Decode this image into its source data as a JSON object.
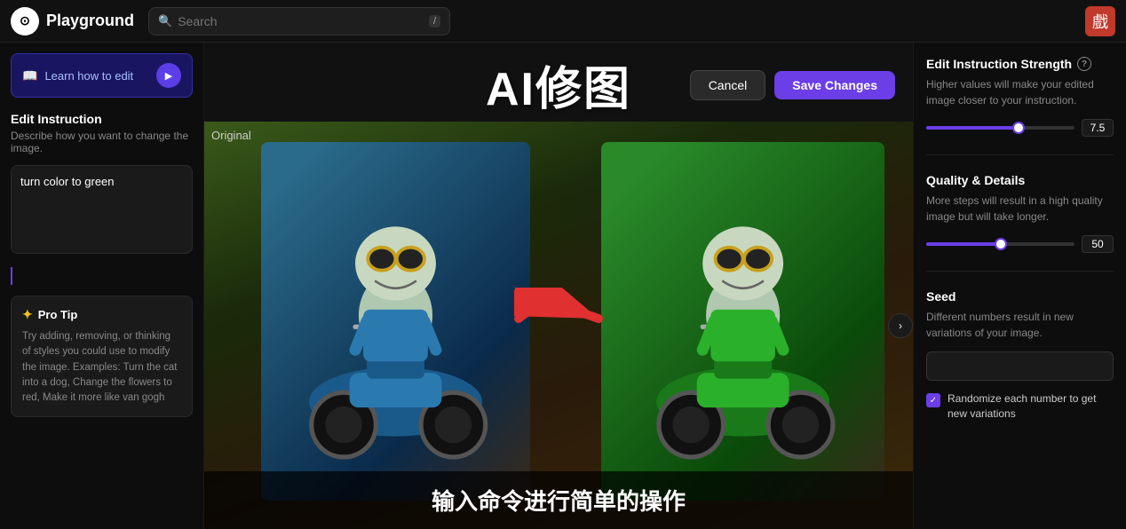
{
  "topnav": {
    "logo_icon": "⊙",
    "logo_text": "Playground",
    "search_placeholder": "Search",
    "search_kbd": "/",
    "avatar_emoji": "戲"
  },
  "sidebar": {
    "learn_btn_label": "Learn how to edit",
    "edit_instruction_title": "Edit Instruction",
    "edit_instruction_desc": "Describe how you want to change the image.",
    "instruction_value": "turn color to green",
    "pro_tip_header": "Pro Tip",
    "pro_tip_text": "Try adding, removing, or thinking of styles you could use to modify the image. Examples: Turn the cat into a dog, Change the flowers to red, Make it more like van gogh"
  },
  "canvas": {
    "title": "AI修图",
    "cancel_label": "Cancel",
    "save_label": "Save Changes",
    "original_label": "Original",
    "caption": "输入命令进行简单的操作"
  },
  "right_panel": {
    "strength_title": "Edit Instruction Strength",
    "strength_desc": "Higher values will make your edited image closer to your instruction.",
    "strength_value": "7.5",
    "strength_pct": 62,
    "quality_title": "Quality & Details",
    "quality_desc": "More steps will result in a high quality image but will take longer.",
    "quality_value": "50",
    "quality_pct": 50,
    "seed_title": "Seed",
    "seed_desc": "Different numbers result in new variations of your image.",
    "seed_placeholder": "",
    "randomize_label": "Randomize each number to get new variations"
  }
}
